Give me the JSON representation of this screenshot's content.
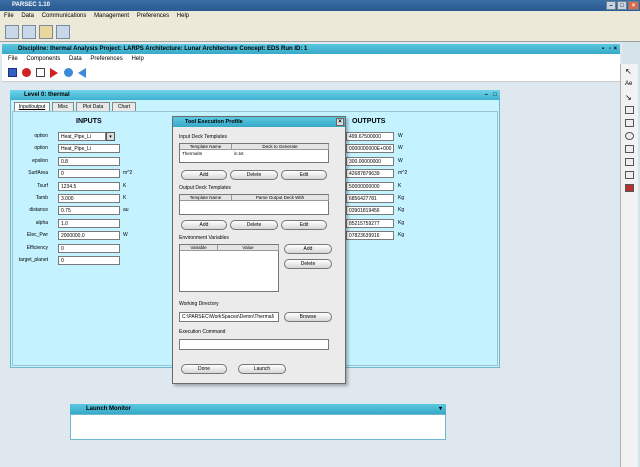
{
  "app": {
    "title": "PARSEC 1.10",
    "menu": [
      "File",
      "Data",
      "Communications",
      "Management",
      "Preferences",
      "Help"
    ]
  },
  "discipline": {
    "title": "Discipline: thermal Analysis  Project: LARPS  Architecture: Lunar Architecture  Concept: EDS  Run ID: 1",
    "menu": [
      "File",
      "Components",
      "Data",
      "Preferences",
      "Help"
    ]
  },
  "level": {
    "title": "Level 0: thermal",
    "tabs": [
      "Input/output",
      "Misc",
      "Plot Data",
      "Chart"
    ]
  },
  "inputs": {
    "title": "INPUTS",
    "rows": [
      {
        "label": "option",
        "value": "Heat_Pipe_Li",
        "unit": ""
      },
      {
        "label": "option",
        "value": "Heat_Pipe_Li",
        "unit": ""
      },
      {
        "label": "epsilon",
        "value": "0.8",
        "unit": ""
      },
      {
        "label": "SurfArea",
        "value": "0",
        "unit": "m^2"
      },
      {
        "label": "Tsurf",
        "value": "1234.5",
        "unit": "K"
      },
      {
        "label": "Tamb",
        "value": "3.000",
        "unit": "K"
      },
      {
        "label": "distance",
        "value": "0.75",
        "unit": "au"
      },
      {
        "label": "alpha",
        "value": "1.0",
        "unit": ""
      },
      {
        "label": "Elec_Pwr",
        "value": "2000000.0",
        "unit": "W"
      },
      {
        "label": "Efficiency",
        "value": "0",
        "unit": ""
      },
      {
        "label": "target_planet",
        "value": "0",
        "unit": ""
      }
    ]
  },
  "outputs": {
    "title": "OUTPUTS",
    "rows": [
      {
        "value": "499.67500000",
        "unit": "W"
      },
      {
        "value": "0000000000E+000",
        "unit": "W"
      },
      {
        "value": "300.00000000",
        "unit": "W"
      },
      {
        "value": "42687879639",
        "unit": "m^2"
      },
      {
        "value": "50000000000",
        "unit": "K"
      },
      {
        "value": "6856427781",
        "unit": "Kg"
      },
      {
        "value": "03901819456",
        "unit": "Kg"
      },
      {
        "value": "85215759277",
        "unit": "Kg"
      },
      {
        "value": "07823639916",
        "unit": "Kg"
      }
    ]
  },
  "dialog": {
    "title": "Tool Execution Profile",
    "input_label": "Input Deck Templates",
    "input_headers": [
      "Template Name",
      "Deck to Generate"
    ],
    "input_row": [
      "ThermalIn",
      "in.txt"
    ],
    "output_label": "Output Deck Templates",
    "output_headers": [
      "Template Name",
      "Parse Output Deck With"
    ],
    "env_label": "Environment Variables",
    "env_headers": [
      "Variable",
      "Value"
    ],
    "add": "Add",
    "delete": "Delete",
    "edit": "Edit",
    "workdir_label": "Working Directory",
    "workdir_value": "C:\\PARSEC\\WorkSpaces\\Demo\\Thermal\\",
    "browse": "Browse",
    "exec_label": "Execution Command",
    "exec_value": "",
    "done": "Done",
    "launch": "Launch"
  },
  "launch_monitor": {
    "title": "Launch Monitor"
  },
  "colors": {
    "accent": "#40b0d0",
    "panel": "#c4f2ff"
  }
}
